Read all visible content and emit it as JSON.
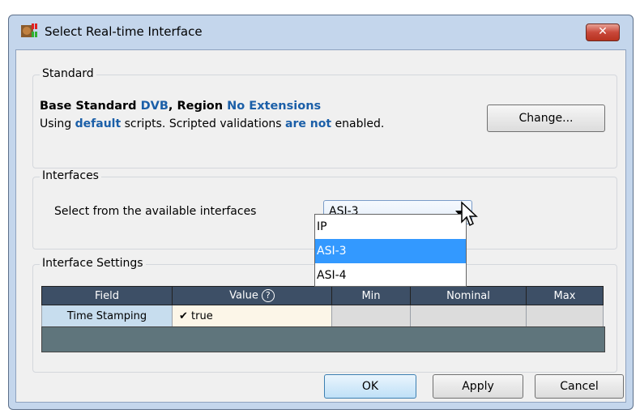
{
  "window": {
    "title": "Select Real-time Interface",
    "close_glyph": "✕"
  },
  "standard": {
    "group_label": "Standard",
    "line1": {
      "p1": "Base Standard ",
      "std": "DVB",
      "p2": ", Region ",
      "region": "No Extensions"
    },
    "line2": {
      "p1": "Using ",
      "scripts": "default",
      "p2": " scripts. Scripted validations ",
      "status": "are not",
      "p3": " enabled."
    },
    "change_button": "Change..."
  },
  "interfaces": {
    "group_label": "Interfaces",
    "prompt": "Select from the available interfaces",
    "selected": "ASI-3",
    "options": [
      "IP",
      "ASI-3",
      "ASI-4"
    ],
    "selected_index": 1
  },
  "settings": {
    "group_label": "Interface Settings",
    "columns": [
      "Field",
      "Value",
      "Min",
      "Nominal",
      "Max"
    ],
    "help_glyph": "?",
    "rows": [
      {
        "field": "Time Stamping",
        "check": "✔",
        "value": "true"
      }
    ]
  },
  "buttons": {
    "ok": "OK",
    "apply": "Apply",
    "cancel": "Cancel"
  },
  "colors": {
    "accent": "#1b5fa8",
    "selection": "#3399ff",
    "grid_header": "#3d4f66"
  }
}
